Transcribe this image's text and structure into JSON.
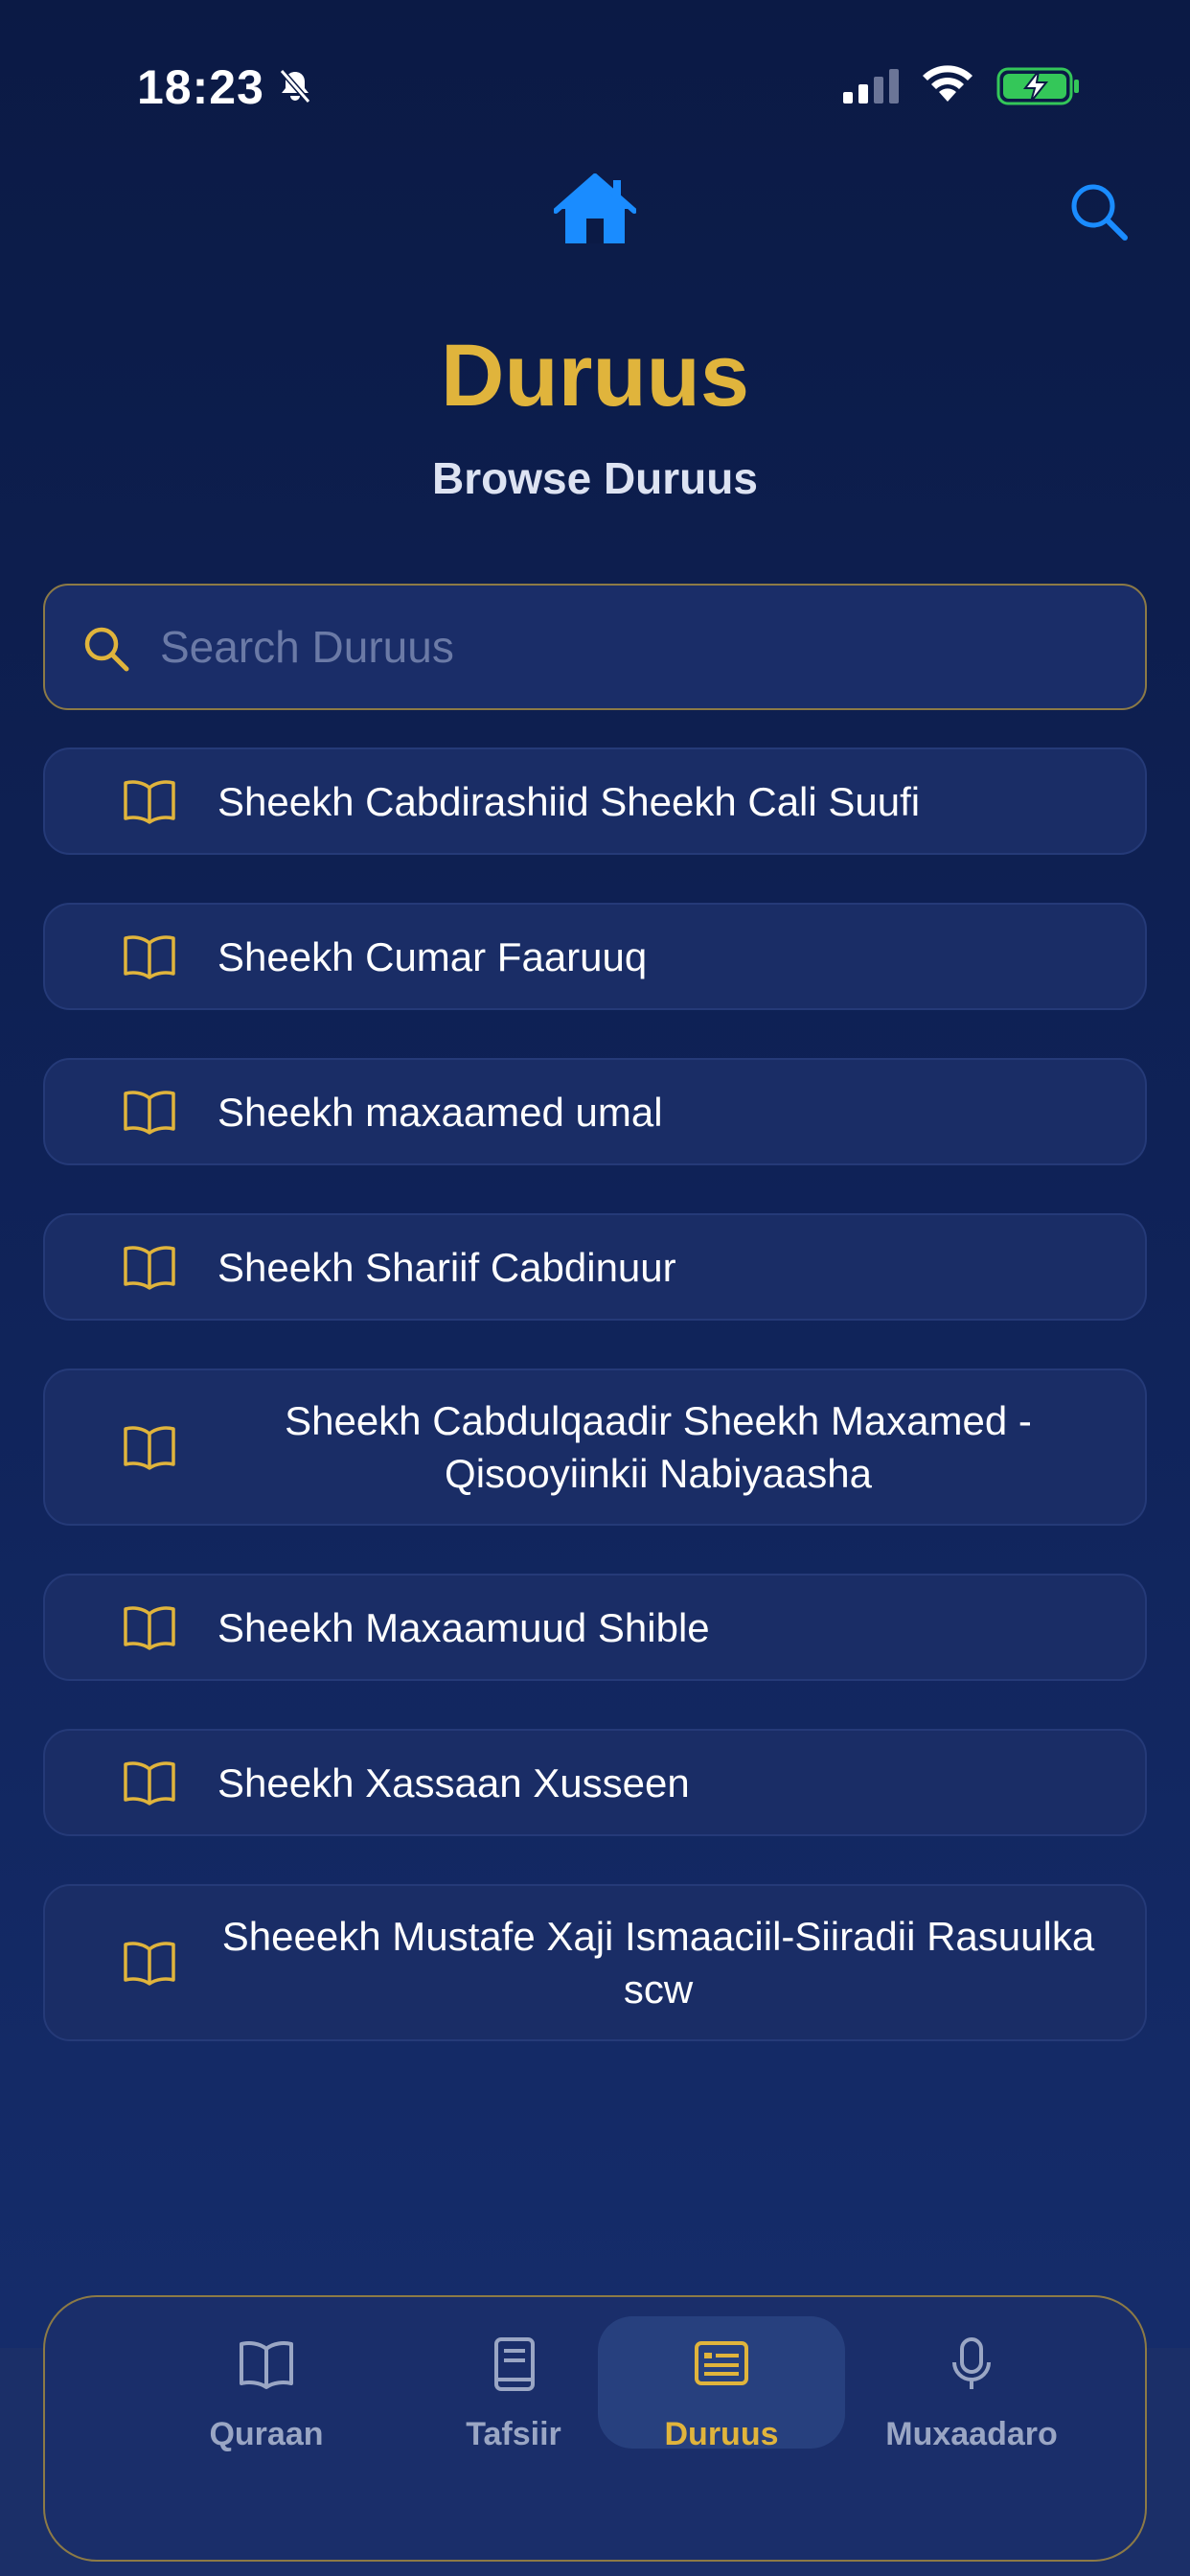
{
  "status_bar": {
    "time": "18:23"
  },
  "header": {
    "title": "Duruus",
    "subtitle": "Browse Duruus"
  },
  "search": {
    "placeholder": "Search Duruus"
  },
  "list": {
    "items": [
      {
        "label": "Sheekh Cabdirashiid Sheekh Cali Suufi"
      },
      {
        "label": "Sheekh Cumar Faaruuq"
      },
      {
        "label": "Sheekh maxaamed umal"
      },
      {
        "label": "Sheekh Shariif Cabdinuur"
      },
      {
        "label": "Sheekh Cabdulqaadir Sheekh Maxamed - Qisooyiinkii Nabiyaasha"
      },
      {
        "label": "Sheekh Maxaamuud Shible"
      },
      {
        "label": "Sheekh Xassaan Xusseen"
      },
      {
        "label": "Sheeekh Mustafe Xaji Ismaaciil-Siiradii Rasuulka scw"
      }
    ]
  },
  "tabs": [
    {
      "label": "Quraan",
      "icon": "open-book-icon"
    },
    {
      "label": "Tafsiir",
      "icon": "book-icon"
    },
    {
      "label": "Duruus",
      "icon": "newspaper-icon",
      "active": true
    },
    {
      "label": "Muxaadaro",
      "icon": "microphone-icon"
    }
  ],
  "colors": {
    "accent": "#e0b43c",
    "home_icon": "#1a8cff",
    "battery": "#34c759"
  }
}
